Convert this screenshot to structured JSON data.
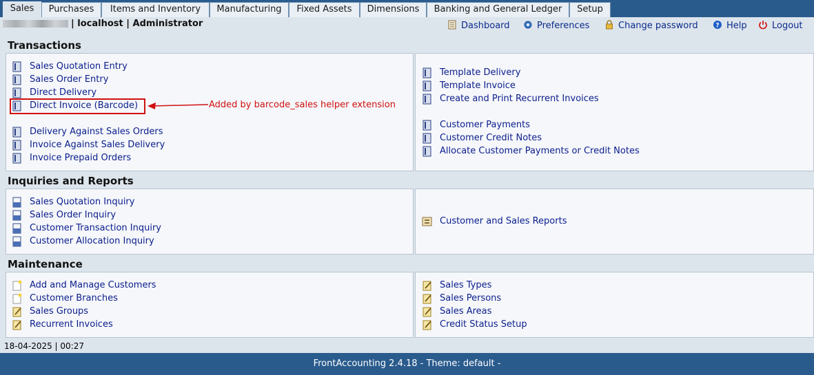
{
  "tabs": [
    {
      "label": "Sales",
      "active": true
    },
    {
      "label": "Purchases"
    },
    {
      "label": "Items and Inventory"
    },
    {
      "label": "Manufacturing"
    },
    {
      "label": "Fixed Assets"
    },
    {
      "label": "Dimensions"
    },
    {
      "label": "Banking and General Ledger"
    },
    {
      "label": "Setup"
    }
  ],
  "user": {
    "host": "| localhost | Administrator"
  },
  "toplinks": {
    "dashboard": "Dashboard",
    "preferences": "Preferences",
    "change_password": "Change password",
    "help": "Help",
    "logout": "Logout"
  },
  "sections": {
    "transactions": "Transactions",
    "inquiries": "Inquiries and Reports",
    "maintenance": "Maintenance"
  },
  "transactions": {
    "left": [
      "Sales Quotation Entry",
      "Sales Order Entry",
      "Direct Delivery",
      "Direct Invoice (Barcode)",
      "Delivery Against Sales Orders",
      "Invoice Against Sales Delivery",
      "Invoice Prepaid Orders"
    ],
    "right": [
      "Template Delivery",
      "Template Invoice",
      "Create and Print Recurrent Invoices",
      "Customer Payments",
      "Customer Credit Notes",
      "Allocate Customer Payments or Credit Notes"
    ]
  },
  "inquiries": {
    "left": [
      "Sales Quotation Inquiry",
      "Sales Order Inquiry",
      "Customer Transaction Inquiry",
      "Customer Allocation Inquiry"
    ],
    "right": [
      "Customer and Sales Reports"
    ]
  },
  "maintenance": {
    "left": [
      "Add and Manage Customers",
      "Customer Branches",
      "Sales Groups",
      "Recurrent Invoices"
    ],
    "right": [
      "Sales Types",
      "Sales Persons",
      "Sales Areas",
      "Credit Status Setup"
    ]
  },
  "annotation": "Added by barcode_sales helper extension",
  "status": "18-04-2025 | 00:27",
  "footer": "FrontAccounting 2.4.18 - Theme: default -",
  "colors": {
    "header": "#2a5b8d",
    "link": "#0b1d8c",
    "annotation": "#d01010"
  }
}
